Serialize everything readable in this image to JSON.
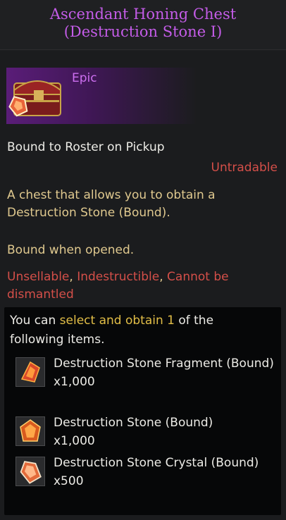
{
  "header": {
    "title_line1": "Ascendant Honing Chest",
    "title_line2": "(Destruction Stone I)"
  },
  "item": {
    "grade": "Epic",
    "icon": "treasure-chest-icon",
    "bind_text": "Bound to Roster on Pickup",
    "trade_status": "Untradable",
    "description": "A chest that allows you to obtain a Destruction Stone (Bound).",
    "bound_note": "Bound when opened.",
    "flags": {
      "unsellable": "Unsellable",
      "sep1": ", ",
      "indestructible": "Indestructible",
      "sep2": ", ",
      "cannot_dismantle": "Cannot be dismantled"
    }
  },
  "selection": {
    "prefix": "You can ",
    "highlight": "select and obtain 1",
    "suffix": " of the following items."
  },
  "rewards": [
    {
      "name": "Destruction Stone Fragment (Bound)",
      "qty": "x1,000",
      "icon": "stone-fragment-icon"
    },
    {
      "name": "Destruction Stone (Bound)",
      "qty": "x1,000",
      "icon": "destruction-stone-icon"
    },
    {
      "name": "Destruction Stone Crystal (Bound)",
      "qty": "x500",
      "icon": "stone-crystal-icon"
    }
  ],
  "colors": {
    "title": "#c45ce8",
    "epic": "#cd6ff0",
    "red": "#d44f49",
    "gold": "#e0c98f",
    "highlight": "#e2be47"
  }
}
